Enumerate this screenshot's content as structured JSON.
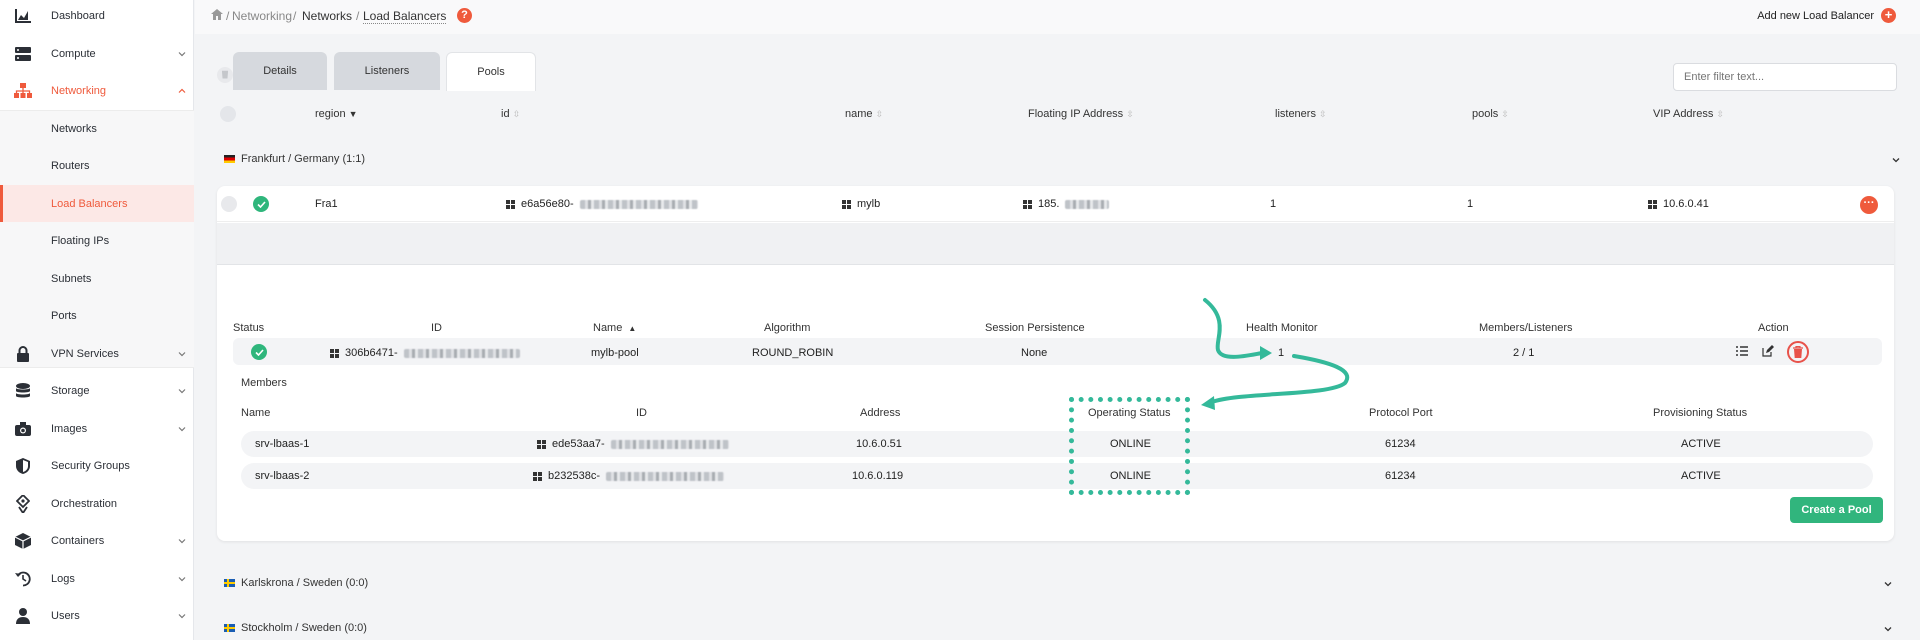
{
  "sidebar": {
    "items": [
      {
        "label": "Dashboard",
        "icon": "chart-icon",
        "expandable": false
      },
      {
        "label": "Compute",
        "icon": "server-icon",
        "expandable": true
      },
      {
        "label": "Networking",
        "icon": "network-icon",
        "expandable": true,
        "active": true
      },
      {
        "label": "VPN Services",
        "icon": "lock-icon",
        "expandable": true
      },
      {
        "label": "Storage",
        "icon": "database-icon",
        "expandable": true
      },
      {
        "label": "Images",
        "icon": "camera-icon",
        "expandable": true
      },
      {
        "label": "Security Groups",
        "icon": "shield-icon",
        "expandable": false
      },
      {
        "label": "Orchestration",
        "icon": "orchestration-icon",
        "expandable": false
      },
      {
        "label": "Containers",
        "icon": "cube-icon",
        "expandable": true
      },
      {
        "label": "Logs",
        "icon": "history-icon",
        "expandable": true
      },
      {
        "label": "Users",
        "icon": "user-icon",
        "expandable": true
      }
    ],
    "networking_subitems": [
      "Networks",
      "Routers",
      "Load Balancers",
      "Floating IPs",
      "Subnets",
      "Ports"
    ],
    "active_subitem": "Load Balancers"
  },
  "breadcrumb": [
    "Networking",
    "Networks",
    "Load Balancers"
  ],
  "header": {
    "add_label": "Add new Load Balancer"
  },
  "filter": {
    "placeholder": "Enter filter text..."
  },
  "table": {
    "columns": [
      "region",
      "id",
      "name",
      "Floating IP Address",
      "listeners",
      "pools",
      "VIP Address"
    ],
    "sorted_column": "region"
  },
  "regions": [
    {
      "label": "Frankfurt / Germany (1:1)",
      "flag": "de"
    },
    {
      "label": "Karlskrona / Sweden (0:0)",
      "flag": "se"
    },
    {
      "label": "Stockholm / Sweden (0:0)",
      "flag": "se"
    }
  ],
  "load_balancer": {
    "region": "Fra1",
    "id": "e6a56e80-",
    "name": "mylb",
    "floating_ip": "185.",
    "listeners": "1",
    "pools": "1",
    "vip": "10.6.0.41"
  },
  "tabs": [
    "Details",
    "Listeners",
    "Pools"
  ],
  "active_tab": "Pools",
  "pools": {
    "columns": [
      "Status",
      "ID",
      "Name",
      "Algorithm",
      "Session Persistence",
      "Health Monitor",
      "Members/Listeners",
      "Action"
    ],
    "row": {
      "id": "306b6471-",
      "name": "mylb-pool",
      "algorithm": "ROUND_ROBIN",
      "session_persistence": "None",
      "health_monitor": "1",
      "members_listeners": "2 / 1"
    }
  },
  "members": {
    "title": "Members",
    "columns": [
      "Name",
      "ID",
      "Address",
      "Operating Status",
      "Protocol Port",
      "Provisioning Status"
    ],
    "rows": [
      {
        "name": "srv-lbaas-1",
        "id": "ede53aa7-",
        "address": "10.6.0.51",
        "operating_status": "ONLINE",
        "protocol_port": "61234",
        "provisioning_status": "ACTIVE"
      },
      {
        "name": "srv-lbaas-2",
        "id": "b232538c-",
        "address": "10.6.0.119",
        "operating_status": "ONLINE",
        "protocol_port": "61234",
        "provisioning_status": "ACTIVE"
      }
    ]
  },
  "create_pool_label": "Create a Pool",
  "colors": {
    "accent": "#ef5a3c",
    "success": "#2fb67c",
    "annotation": "#34b99a"
  }
}
